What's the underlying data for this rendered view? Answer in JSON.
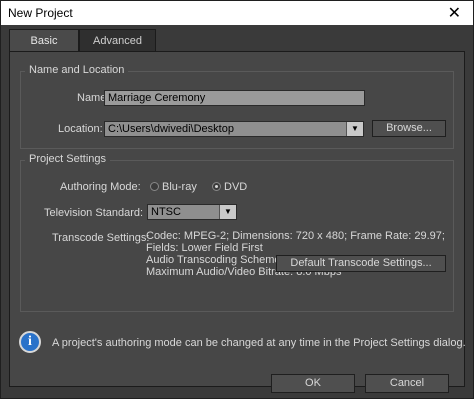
{
  "window": {
    "title": "New Project",
    "close_glyph": "✕"
  },
  "tabs": [
    {
      "label": "Basic",
      "active": true
    },
    {
      "label": "Advanced",
      "active": false
    }
  ],
  "name_location": {
    "legend": "Name and Location",
    "name_label": "Name:",
    "name_value": "Marriage Ceremony",
    "location_label": "Location:",
    "location_value": "C:\\Users\\dwivedi\\Desktop",
    "browse_label": "Browse..."
  },
  "project_settings": {
    "legend": "Project Settings",
    "authoring_mode_label": "Authoring Mode:",
    "authoring_options": [
      {
        "label": "Blu-ray",
        "selected": false
      },
      {
        "label": "DVD",
        "selected": true
      }
    ],
    "tv_standard_label": "Television Standard:",
    "tv_standard_value": "NTSC",
    "transcode_label": "Transcode Settings:",
    "transcode_lines": [
      "Codec: MPEG-2; Dimensions: 720 x 480; Frame Rate: 29.97;",
      "Fields: Lower Field First",
      "Audio Transcoding Scheme: Dolby Digital",
      "Maximum Audio/Video Bitrate: 8.0 Mbps"
    ],
    "default_transcode_button": "Default Transcode Settings..."
  },
  "info": {
    "icon": "info-icon",
    "icon_glyph": "i",
    "text": "A project's authoring mode can be changed at any time in the Project Settings dialog."
  },
  "buttons": {
    "ok": "OK",
    "cancel": "Cancel"
  }
}
